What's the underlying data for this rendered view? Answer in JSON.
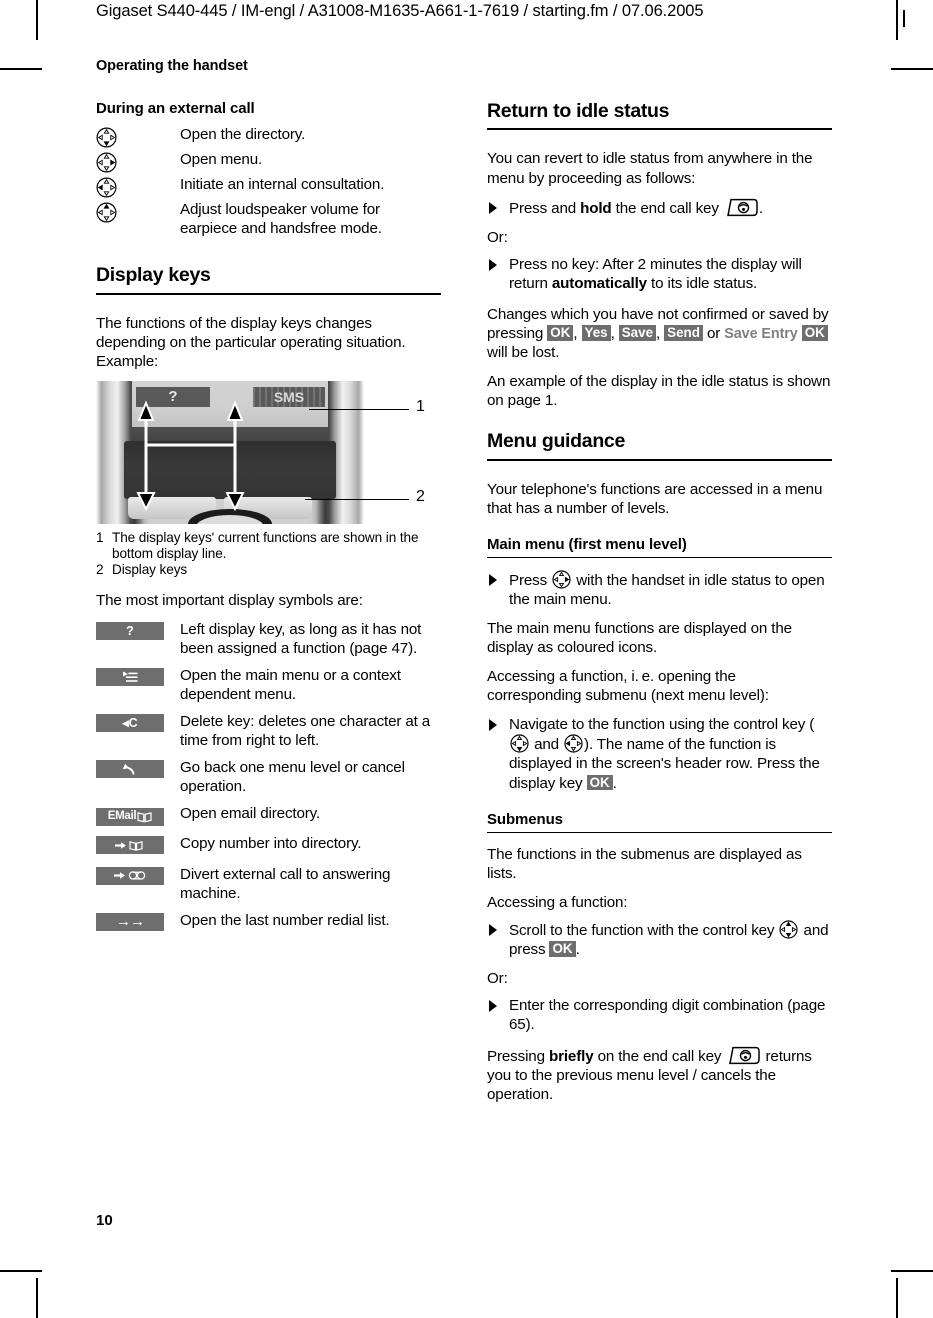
{
  "header": {
    "running_head": "Gigaset S440-445 / IM-engl / A31008-M1635-A661-1-7619 / starting.fm / 07.06.2005",
    "chapter": "Operating the handset"
  },
  "folio": "10",
  "left_column": {
    "external_call": {
      "heading": "During an external call",
      "rows": [
        {
          "icon": "control-key-down-icon",
          "direction": "down",
          "text": "Open the directory."
        },
        {
          "icon": "control-key-right-icon",
          "direction": "right",
          "text": "Open menu."
        },
        {
          "icon": "control-key-left-icon",
          "direction": "left",
          "text": "Initiate an internal consultation."
        },
        {
          "icon": "control-key-up-icon",
          "direction": "up",
          "text": "Adjust loudspeaker volume for earpiece and handsfree mode."
        }
      ]
    },
    "display_keys": {
      "heading": "Display keys",
      "intro": "The functions of the display keys changes depending on the particular operating situation. Example:",
      "figure": {
        "softkey_left": "?",
        "softkey_right": "SMS",
        "callout_1": "1",
        "callout_2": "2"
      },
      "caption": [
        {
          "num": "1",
          "text": "The display keys' current functions are shown in the bottom display line."
        },
        {
          "num": "2",
          "text": "Display keys"
        }
      ],
      "symbols_intro": "The most important display symbols are:",
      "symbols": [
        {
          "icon": "question-mark-softkey-icon",
          "label": "?",
          "text": "Left display key, as long as it has not been assigned a function (page 47)."
        },
        {
          "icon": "menu-list-softkey-icon",
          "label": "",
          "text": "Open the main menu or a context dependent menu."
        },
        {
          "icon": "delete-backspace-softkey-icon",
          "label": "◂C",
          "text": "Delete key: deletes one character at a time from right to left."
        },
        {
          "icon": "back-arrow-softkey-icon",
          "label": "↶",
          "text": "Go back one menu level or cancel operation."
        },
        {
          "icon": "email-directory-softkey-icon",
          "label": "EMail",
          "text": "Open email directory."
        },
        {
          "icon": "copy-to-directory-softkey-icon",
          "label": "",
          "text": "Copy number into directory."
        },
        {
          "icon": "divert-to-answering-machine-softkey-icon",
          "label": "",
          "text": "Divert external call to answering machine."
        },
        {
          "icon": "redial-list-softkey-icon",
          "label": "→→",
          "text": "Open the last number redial list."
        }
      ]
    }
  },
  "right_column": {
    "return_idle": {
      "heading": "Return to idle status",
      "intro": "You can revert to idle status from anywhere in the menu by proceeding as follows:",
      "step_1_pre": "Press and ",
      "step_1_bold": "hold",
      "step_1_post": " the end call key ",
      "step_1_end": ".",
      "or": "Or:",
      "step_2_pre": "Press no key: After 2 minutes the display will return ",
      "step_2_bold": "automatically",
      "step_2_post": " to its idle status.",
      "changes_pre": "Changes which you have not confirmed or saved by pressing ",
      "badge_ok": "OK",
      "badge_yes": "Yes",
      "badge_save": "Save",
      "badge_send": "Send",
      "changes_or": " or",
      "save_entry_label": "Save Entry",
      "changes_post": " will be lost.",
      "example": "An example of the display in the idle status is shown on page 1."
    },
    "menu_guidance": {
      "heading": "Menu guidance",
      "intro": "Your telephone's functions are accessed in a menu that has a number of levels."
    },
    "main_menu": {
      "heading": "Main menu (first menu level)",
      "step_pre": "Press ",
      "step_post": " with the handset in idle status to open the main menu.",
      "para_1": "The main menu functions are displayed on the display as coloured icons.",
      "para_2": "Accessing a function, i. e. opening the corresponding submenu (next menu level):",
      "nav_pre": "Navigate to the function using the control key (",
      "nav_mid": " and ",
      "nav_post": "). The name of the function is displayed in the screen's header row. Press the display key ",
      "nav_badge": "OK",
      "nav_end": "."
    },
    "submenus": {
      "heading": "Submenus",
      "intro": "The functions in the submenus are displayed as lists.",
      "accessing": "Accessing a function:",
      "step_1_pre": "Scroll to the function with the control key ",
      "step_1_mid": " and press ",
      "step_1_badge": "OK",
      "step_1_end": ".",
      "or": "Or:",
      "step_2": "Enter the corresponding digit combination (page 65).",
      "closing_pre": "Pressing ",
      "closing_bold": "briefly",
      "closing_mid": " on the end call key ",
      "closing_post": " returns you to the previous menu level / cancels the operation."
    }
  },
  "colors": {
    "softkey_bg": "#6e6e6e",
    "softkey_text": "#ffffff",
    "save_entry_text": "#808080",
    "text": "#000000"
  }
}
